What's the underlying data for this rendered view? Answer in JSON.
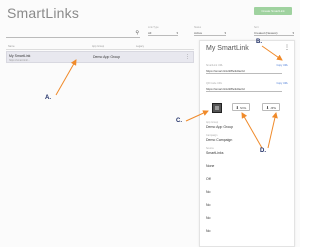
{
  "page": {
    "title": "SmartLinks",
    "create_label": "Create SmartLink"
  },
  "filters": [
    {
      "label": "Link Type",
      "value": "All"
    },
    {
      "label": "Status",
      "value": "Active"
    },
    {
      "label": "Sort",
      "value": "Created (Newest)"
    }
  ],
  "table": {
    "columns": [
      "Name",
      "App Group",
      "Legacy"
    ],
    "rows": [
      {
        "name": "My SmartLink",
        "sub": "https://smart.link/...",
        "app_group": "Demo App Group"
      }
    ]
  },
  "panel": {
    "title": "My SmartLink",
    "url_label": "SmartLink URL",
    "copy_label": "Copy URL",
    "url": "https://smart.link/28fe3d4e3d",
    "qr_label": "QR Code URL",
    "qr_url": "https://smart.link/28fe3d4e3d",
    "downloads": [
      "SVG",
      "JPG"
    ],
    "fields": [
      {
        "label": "App Group",
        "value": "Demo App Group"
      },
      {
        "label": "Campaign",
        "value": "Demo Campaign"
      },
      {
        "label": "Source",
        "value": "SmartLinks"
      },
      {
        "label": "",
        "value": "None"
      },
      {
        "label": "",
        "value": "Off"
      },
      {
        "label": "",
        "value": "No"
      },
      {
        "label": "",
        "value": "No"
      },
      {
        "label": "",
        "value": "No"
      },
      {
        "label": "",
        "value": "No"
      }
    ]
  },
  "annotations": [
    "A.",
    "B.",
    "C.",
    "D."
  ],
  "colors": {
    "accent_button": "#9fd29f",
    "link": "#4a7bd6",
    "arrow": "#f08a2a",
    "annotation_text": "#1e2e66",
    "selected_row": "#e8e8ef"
  },
  "icons": [
    "search-icon",
    "chevron-down-icon",
    "kebab-menu-icon",
    "qr-code-icon",
    "download-icon"
  ]
}
